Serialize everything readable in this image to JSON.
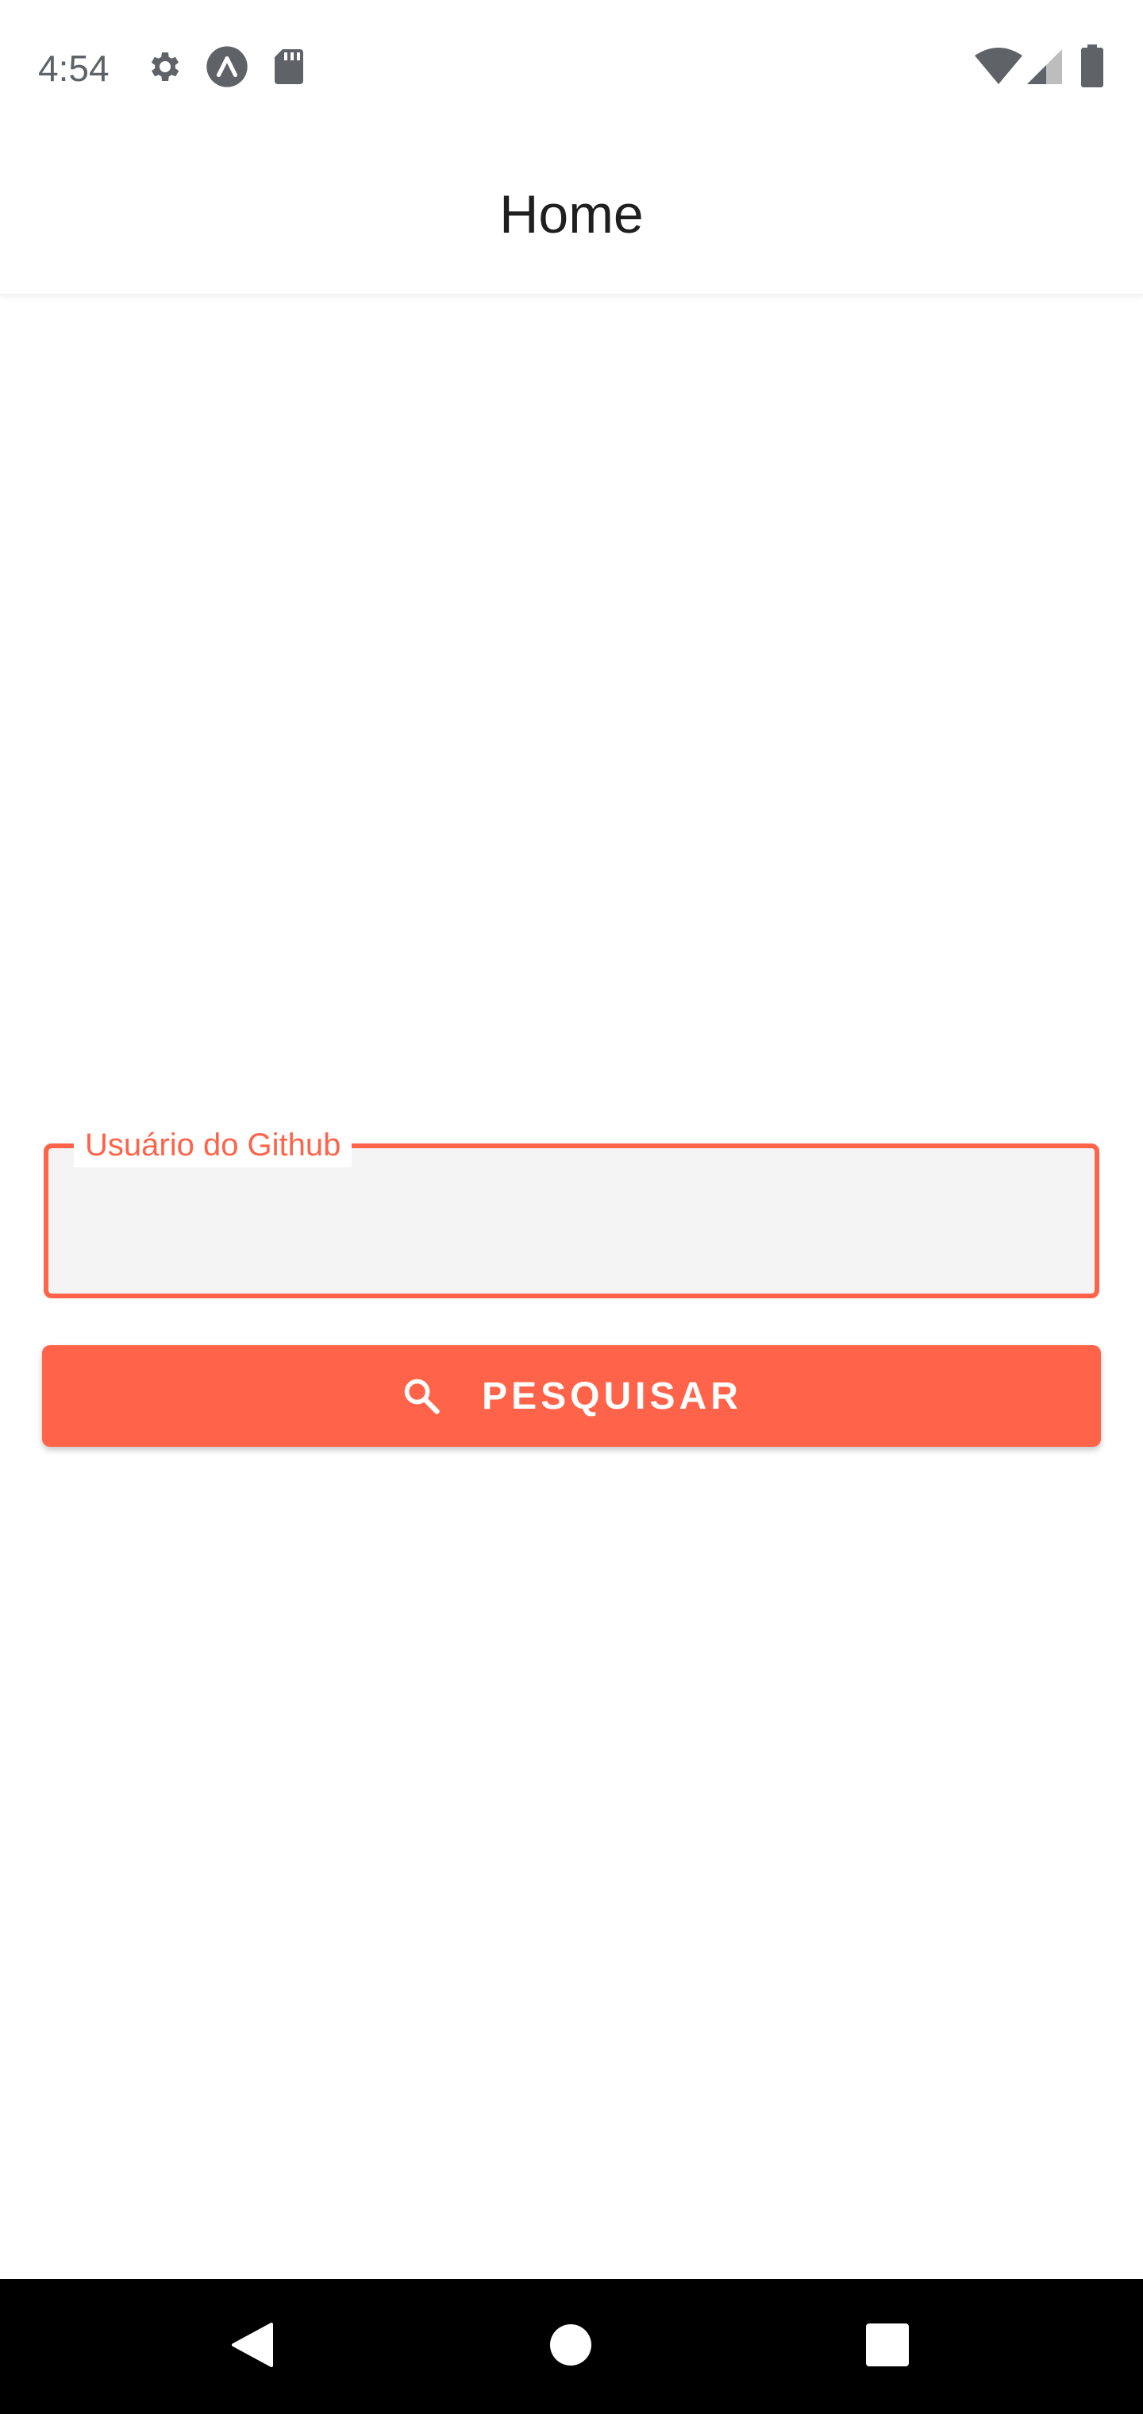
{
  "status_bar": {
    "time": "4:54",
    "icons": [
      "settings-gear-icon",
      "expo-icon",
      "sd-card-icon",
      "wifi-icon",
      "cell-signal-icon",
      "battery-icon"
    ]
  },
  "app_bar": {
    "title": "Home"
  },
  "form": {
    "username_label": "Usuário do Github",
    "username_value": "",
    "search_button_label": "PESQUISAR",
    "search_button_icon": "search-icon"
  },
  "nav_bar": {
    "buttons": [
      "back-icon",
      "home-icon",
      "recents-icon"
    ]
  },
  "colors": {
    "accent": "#ff6349",
    "input_bg": "#f4f4f4",
    "nav_bg": "#000000"
  }
}
